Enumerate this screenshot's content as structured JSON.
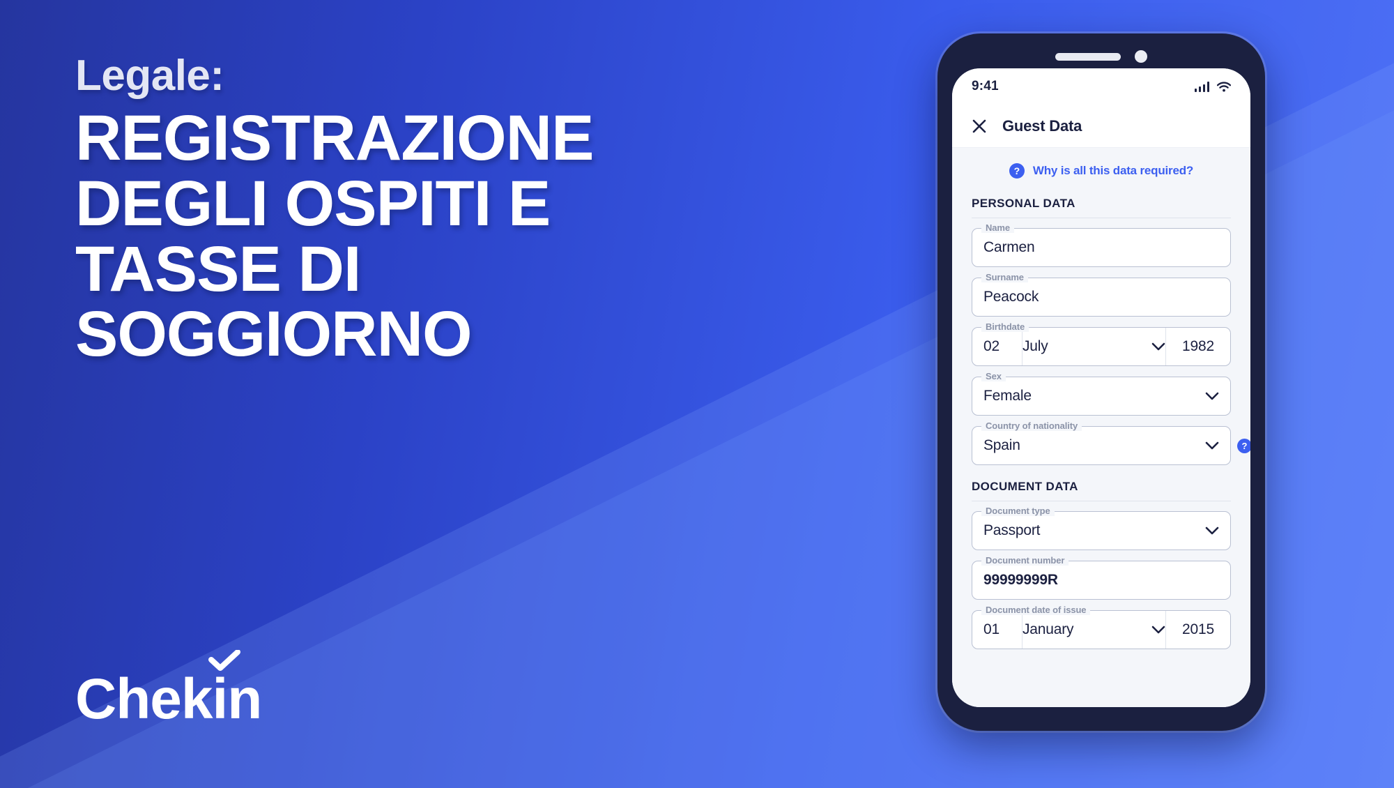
{
  "brand": {
    "name": "Chekin",
    "logo_check_icon": "check-icon"
  },
  "hero": {
    "eyebrow": "Legale:",
    "headline_lines": [
      "REGISTRAZIONE",
      "DEGLI OSPITI E",
      "TASSE DI",
      "SOGGIORNO"
    ]
  },
  "colors": {
    "background_dark": "#25359f",
    "background_light": "#4f72f6",
    "accent_blue": "#3c5ff0",
    "phone_frame": "#1b2040",
    "screen_bg": "#f4f6fa",
    "text_dark": "#1b2040",
    "label_gray": "#8b93a8",
    "eyebrow": "#e3e6f4"
  },
  "phone": {
    "statusbar": {
      "time": "9:41",
      "signal_icon": "signal-bars-icon",
      "wifi_icon": "wifi-icon"
    },
    "appbar": {
      "close_icon": "close-icon",
      "title": "Guest Data"
    },
    "help_link": {
      "badge": "?",
      "text": "Why is all this data required?"
    },
    "sections": [
      {
        "title": "PERSONAL DATA",
        "fields": [
          {
            "label": "Name",
            "value": "Carmen",
            "type": "text"
          },
          {
            "label": "Surname",
            "value": "Peacock",
            "type": "text"
          },
          {
            "label": "Birthdate",
            "type": "date",
            "day": "02",
            "month": "July",
            "year": "1982"
          },
          {
            "label": "Sex",
            "value": "Female",
            "type": "select"
          },
          {
            "label": "Country of nationality",
            "value": "Spain",
            "type": "select",
            "help_badge": "?"
          }
        ]
      },
      {
        "title": "DOCUMENT DATA",
        "fields": [
          {
            "label": "Document type",
            "value": "Passport",
            "type": "select"
          },
          {
            "label": "Document number",
            "value": "99999999R",
            "type": "text",
            "bold": true
          },
          {
            "label": "Document date of issue",
            "type": "date",
            "day": "01",
            "month": "January",
            "year": "2015"
          }
        ]
      }
    ]
  }
}
